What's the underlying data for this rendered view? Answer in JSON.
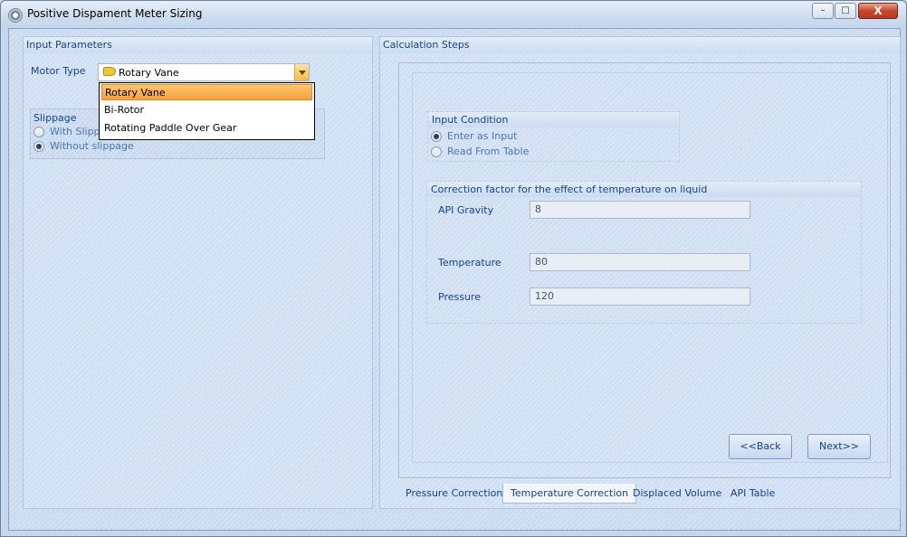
{
  "window": {
    "title": "Positive Dispament Meter Sizing",
    "minimize": "–",
    "maximize": "□",
    "close": "X"
  },
  "input_parameters": {
    "header": "Input Parameters",
    "motor_type_label": "Motor Type",
    "motor_type_value": "Rotary Vane",
    "dropdown_options": [
      "Rotary Vane",
      "Bi-Rotor",
      "Rotating Paddle Over Gear"
    ],
    "selected_option_index": 0,
    "slippage": {
      "title": "Slippage",
      "options": [
        "With Slippage",
        "Without slippage"
      ],
      "selected": "Without slippage"
    }
  },
  "calculation_steps": {
    "header": "Calculation Steps",
    "input_condition": {
      "title": "Input Condition",
      "options": [
        "Enter as Input",
        "Read From Table"
      ],
      "selected": "Enter as Input"
    },
    "correction": {
      "title": "Correction factor for the effect of temperature  on liquid",
      "fields": [
        {
          "label": "API Gravity",
          "value": "8"
        },
        {
          "label": "Temperature",
          "value": "80"
        },
        {
          "label": "Pressure",
          "value": "120"
        }
      ]
    },
    "back_button": "<<Back",
    "next_button": "Next>>",
    "tabs": [
      "Pressure Correction",
      "Temperature Correction",
      "Displaced Volume",
      "API Table"
    ],
    "active_tab": "Temperature Correction"
  },
  "colors": {
    "accent": "#15428b",
    "selection": "#f7a23b",
    "background": "#c7d7ec"
  }
}
